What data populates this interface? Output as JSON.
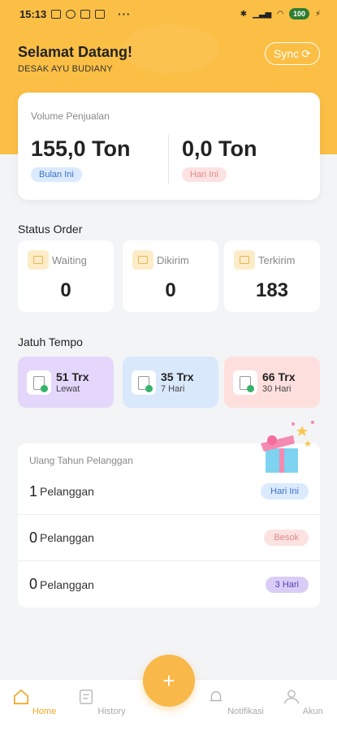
{
  "status_bar": {
    "time": "15:13",
    "more": "···",
    "battery": "100"
  },
  "header": {
    "greeting": "Selamat Datang!",
    "user_name": "DESAK AYU BUDIANY",
    "sync_label": "Sync"
  },
  "volume": {
    "label": "Volume Penjualan",
    "month_value": "155,0 Ton",
    "month_label": "Bulan Ini",
    "today_value": "0,0 Ton",
    "today_label": "Hari Ini"
  },
  "status_order": {
    "title": "Status Order",
    "items": [
      {
        "label": "Waiting",
        "value": "0"
      },
      {
        "label": "Dikirim",
        "value": "0"
      },
      {
        "label": "Terkirim",
        "value": "183"
      }
    ]
  },
  "jatuh_tempo": {
    "title": "Jatuh Tempo",
    "items": [
      {
        "value": "51 Trx",
        "label": "Lewat",
        "color": "#e4d7fb"
      },
      {
        "value": "35 Trx",
        "label": "7 Hari",
        "color": "#d9e8fb"
      },
      {
        "value": "66 Trx",
        "label": "30 Hari",
        "color": "#fde0de"
      }
    ]
  },
  "birthday": {
    "title": "Ulang Tahun Pelanggan",
    "rows": [
      {
        "count": "1",
        "unit": "Pelanggan",
        "badge": "Hari Ini"
      },
      {
        "count": "0",
        "unit": "Pelanggan",
        "badge": "Besok"
      },
      {
        "count": "0",
        "unit": "Pelanggan",
        "badge": "3 Hari"
      }
    ]
  },
  "nav": {
    "fab_label": "+",
    "items": [
      {
        "label": "Home",
        "icon": "home-icon"
      },
      {
        "label": "History",
        "icon": "history-icon"
      },
      {
        "label": "Notifikasi",
        "icon": "notification-icon"
      },
      {
        "label": "Akun",
        "icon": "account-icon"
      }
    ]
  },
  "colors": {
    "accent": "#fbbf45",
    "active_nav": "#f5a623"
  }
}
